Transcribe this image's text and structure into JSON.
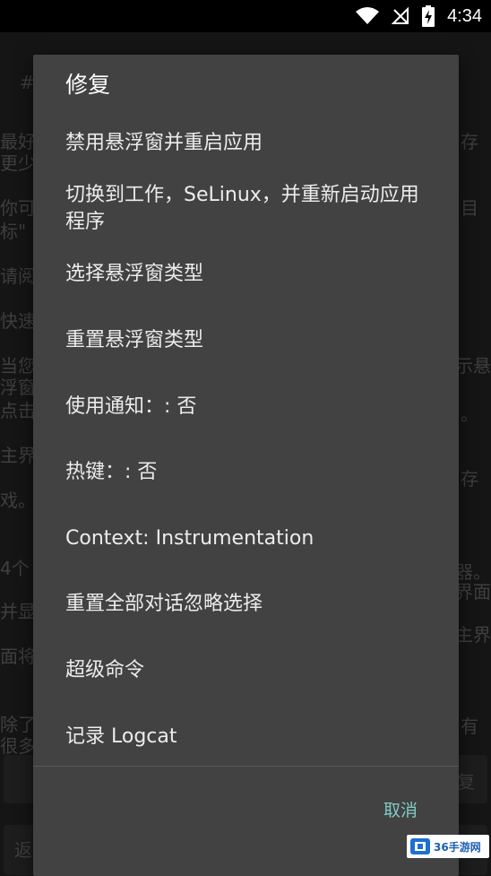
{
  "status_bar": {
    "time": "4:34",
    "icons": [
      "wifi-icon",
      "no-signal-icon",
      "battery-charging-icon"
    ]
  },
  "background": {
    "lines": [
      {
        "text": "#",
        "left": ""
      },
      {
        "text": "最好"
      },
      {
        "text": "更少"
      },
      {
        "text": "你可"
      },
      {
        "text": "标\""
      },
      {
        "text": "请阅"
      },
      {
        "text": "快速"
      },
      {
        "text": "当您"
      },
      {
        "text": "浮窗"
      },
      {
        "text": "点击"
      },
      {
        "text": "主界"
      },
      {
        "text": "戏。"
      },
      {
        "text": "4个"
      },
      {
        "text": "并显"
      },
      {
        "text": "面将"
      },
      {
        "text": "除了"
      },
      {
        "text": "很多"
      },
      {
        "text": "返"
      }
    ],
    "right_lines": [
      {
        "text": "存"
      },
      {
        "text": "目"
      },
      {
        "text": "示悬"
      },
      {
        "text": "。"
      },
      {
        "text": "存"
      },
      {
        "text": "器。"
      },
      {
        "text": "界面"
      },
      {
        "text": "主界"
      },
      {
        "text": "有"
      },
      {
        "text": "复"
      }
    ]
  },
  "dialog": {
    "title": "修复",
    "items": [
      {
        "label": "禁用悬浮窗并重启应用"
      },
      {
        "label": "切换到工作，SeLinux，并重新启动应用程序"
      },
      {
        "label": "选择悬浮窗类型"
      },
      {
        "label": "重置悬浮窗类型"
      },
      {
        "label": "使用通知：: 否"
      },
      {
        "label": "热键：: 否"
      },
      {
        "label": "Context: Instrumentation"
      },
      {
        "label": "重置全部对话忽略选择"
      },
      {
        "label": "超级命令"
      },
      {
        "label": "记录 Logcat"
      }
    ],
    "cancel_label": "取消"
  },
  "watermark": {
    "text": "36手游网"
  }
}
